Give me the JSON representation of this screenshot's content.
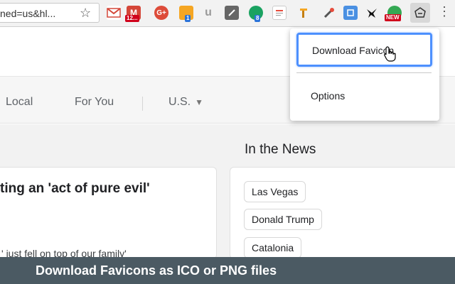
{
  "browser": {
    "url_text": "ned=us&hl...",
    "badges": {
      "gmail": "12...",
      "ext_blue": "8",
      "ext_orange": "1",
      "ext_new": "NEW"
    }
  },
  "popup": {
    "download_label": "Download Favicon",
    "options_label": "Options"
  },
  "nav": {
    "items": [
      "Local",
      "For You",
      "U.S."
    ]
  },
  "main": {
    "headline": "ting an 'act of pure evil'",
    "snippet": "' just fell on top of our family'"
  },
  "news": {
    "title": "In the News",
    "chips": [
      "Las Vegas",
      "Donald Trump",
      "Catalonia"
    ]
  },
  "caption": "Download Favicons as ICO or PNG files"
}
